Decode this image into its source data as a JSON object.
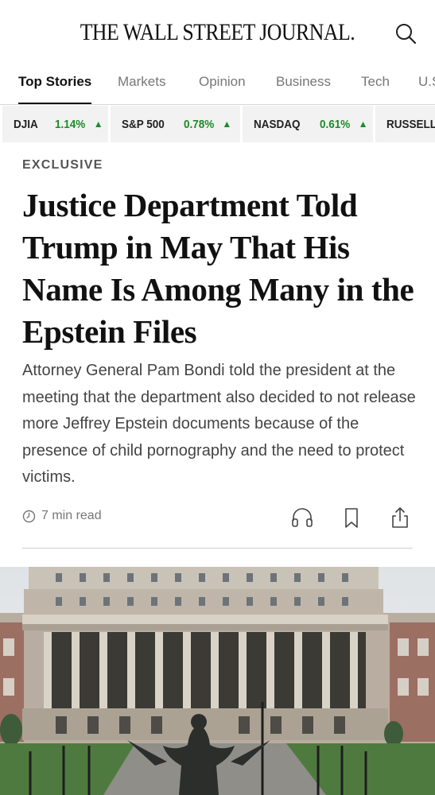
{
  "header": {
    "logo": "THE WALL STREET JOURNAL.",
    "search_icon": "search-icon"
  },
  "nav": {
    "tabs": [
      {
        "label": "Top Stories",
        "active": true
      },
      {
        "label": "Markets",
        "active": false
      },
      {
        "label": "Opinion",
        "active": false
      },
      {
        "label": "Business",
        "active": false
      },
      {
        "label": "Tech",
        "active": false
      },
      {
        "label": "U.S.",
        "active": false
      }
    ]
  },
  "ticker": [
    {
      "name": "DJIA",
      "change": "1.14%",
      "direction": "up"
    },
    {
      "name": "S&P 500",
      "change": "0.78%",
      "direction": "up"
    },
    {
      "name": "NASDAQ",
      "change": "0.61%",
      "direction": "up"
    },
    {
      "name": "RUSSELL",
      "change": "",
      "direction": "up"
    }
  ],
  "colors": {
    "positive": "#1e8a28",
    "ticker_bg": "#f2f2f2",
    "text": "#111111",
    "muted": "#777777"
  },
  "article": {
    "kicker": "EXCLUSIVE",
    "headline": "Justice Department Told Trump in May That His Name Is Among Many in the Epstein Files",
    "summary": "Attorney General Pam Bondi told the president at the meeting that the department also decided to not release more Jeffrey Epstein documents because of the presence of child pornography and the need to protect victims.",
    "read_time": "7 min read",
    "actions": [
      "headphones-icon",
      "bookmark-icon",
      "share-icon"
    ]
  }
}
